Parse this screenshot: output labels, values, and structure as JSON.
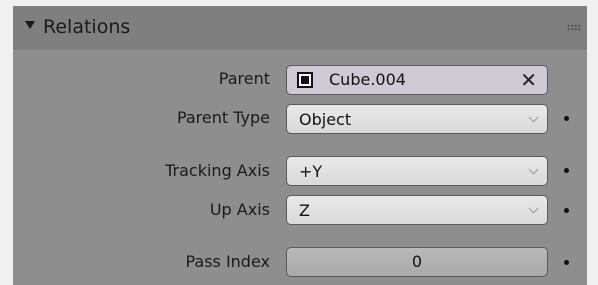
{
  "panel": {
    "title": "Relations"
  },
  "rows": {
    "parent": {
      "label": "Parent",
      "value": "Cube.004",
      "clear": "✕"
    },
    "parent_type": {
      "label": "Parent Type",
      "value": "Object"
    },
    "tracking_axis": {
      "label": "Tracking Axis",
      "value": "+Y"
    },
    "up_axis": {
      "label": "Up Axis",
      "value": "Z"
    },
    "pass_index": {
      "label": "Pass Index",
      "value": "0"
    }
  }
}
